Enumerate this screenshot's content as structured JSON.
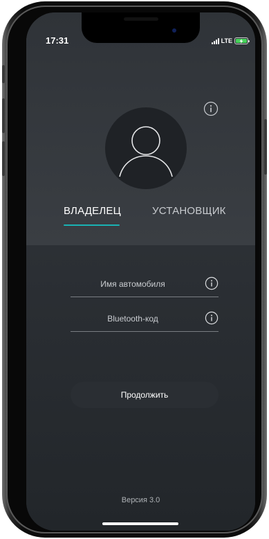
{
  "status_bar": {
    "time": "17:31",
    "network": "LTE",
    "signal_icon": "signal-bars-icon",
    "battery_icon": "battery-charging-icon"
  },
  "profile": {
    "avatar_icon": "user-avatar-icon",
    "info_icon": "info-icon"
  },
  "tabs": [
    {
      "label": "ВЛАДЕЛЕЦ",
      "active": true
    },
    {
      "label": "УСТАНОВЩИК",
      "active": false
    }
  ],
  "form": {
    "car_name": {
      "placeholder": "Имя автомобиля",
      "value": "",
      "info_icon": "info-icon"
    },
    "bluetooth_code": {
      "placeholder": "Bluetooth-код",
      "value": "",
      "info_icon": "info-icon"
    },
    "continue_label": "Продолжить"
  },
  "footer": {
    "version": "Версия 3.0"
  },
  "colors": {
    "accent": "#19b3b3",
    "background_top": "#3a3e43",
    "background_bottom": "#22262a",
    "button": "#2a2e33",
    "battery": "#46d35a"
  }
}
